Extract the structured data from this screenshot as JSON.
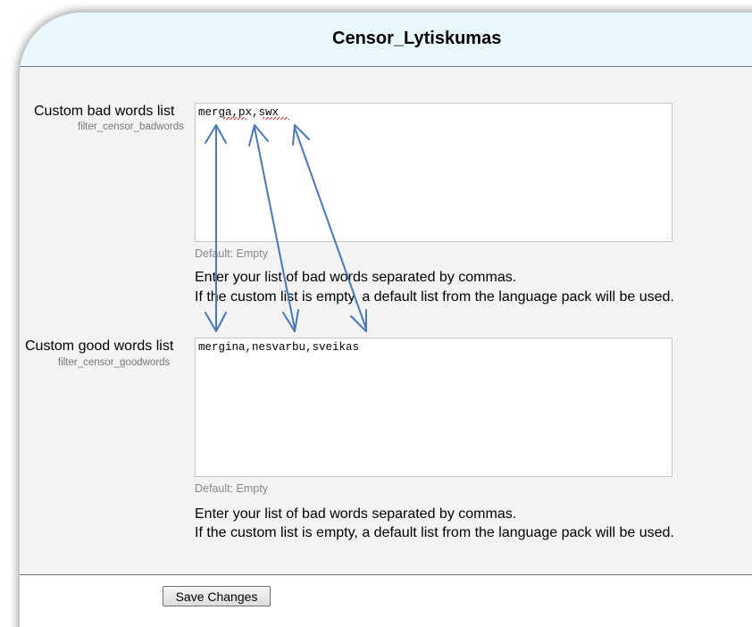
{
  "header": {
    "title": "Censor_Lytiskumas"
  },
  "bad_words": {
    "label": "Custom bad words list",
    "setting_name": "filter_censor_badwords",
    "value": "merga,px,swx",
    "default": "Default: Empty",
    "description_line1": "Enter your list of bad words separated by commas.",
    "description_line2": "If the custom list is empty, a default list from the language pack will be used."
  },
  "good_words": {
    "label": "Custom good words list",
    "setting_name": "filter_censor_goodwords",
    "value": "mergina,nesvarbu,sveikas",
    "default": "Default: Empty",
    "description_line1": "Enter your list of bad words separated by commas.",
    "description_line2": "If the custom list is empty, a default list from the language pack will be used."
  },
  "footer": {
    "save_label": "Save Changes"
  },
  "annotation": {
    "arrow_color": "#4a78b8"
  }
}
